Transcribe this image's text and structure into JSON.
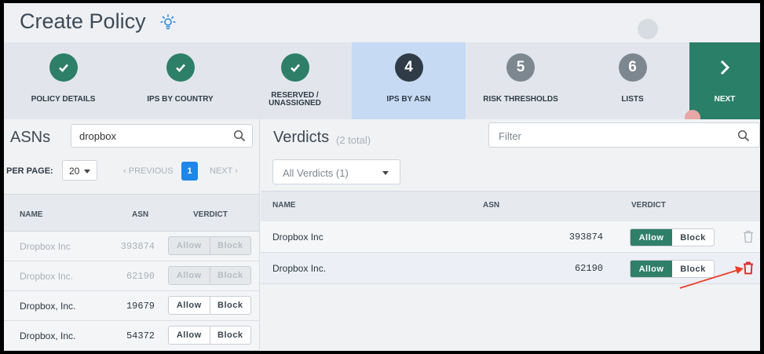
{
  "header": {
    "title": "Create Policy",
    "help_icon": "lightbulb-icon"
  },
  "stepper": {
    "steps": [
      {
        "number": "",
        "label": "POLICY DETAILS",
        "state": "done"
      },
      {
        "number": "",
        "label": "IPS BY COUNTRY",
        "state": "done"
      },
      {
        "number": "",
        "label": "RESERVED / UNASSIGNED",
        "state": "done"
      },
      {
        "number": "4",
        "label": "IPS BY ASN",
        "state": "active"
      },
      {
        "number": "5",
        "label": "RISK THRESHOLDS",
        "state": "todo"
      },
      {
        "number": "6",
        "label": "LISTS",
        "state": "todo"
      }
    ],
    "next_label": "NEXT"
  },
  "asns": {
    "title": "ASNs",
    "search_value": "dropbox",
    "per_page_label": "PER PAGE:",
    "per_page_value": "20",
    "prev_label": "PREVIOUS",
    "page": "1",
    "next_label": "NEXT",
    "columns": {
      "name": "NAME",
      "asn": "ASN",
      "verdict": "VERDICT"
    },
    "rows": [
      {
        "name": "Dropbox Inc",
        "asn": "393874",
        "allow": "Allow",
        "block": "Block",
        "disabled": true
      },
      {
        "name": "Dropbox Inc.",
        "asn": "62190",
        "allow": "Allow",
        "block": "Block",
        "disabled": true
      },
      {
        "name": "Dropbox, Inc.",
        "asn": "19679",
        "allow": "Allow",
        "block": "Block",
        "disabled": false
      },
      {
        "name": "Dropbox, Inc.",
        "asn": "54372",
        "allow": "Allow",
        "block": "Block",
        "disabled": false
      }
    ]
  },
  "verdicts": {
    "title": "Verdicts",
    "total": "(2 total)",
    "filter_placeholder": "Filter",
    "dropdown_value": "All Verdicts (1)",
    "columns": {
      "name": "NAME",
      "asn": "ASN",
      "verdict": "VERDICT"
    },
    "rows": [
      {
        "name": "Dropbox Inc",
        "asn": "393874",
        "allow": "Allow",
        "block": "Block",
        "selected": "Allow"
      },
      {
        "name": "Dropbox Inc.",
        "asn": "62190",
        "allow": "Allow",
        "block": "Block",
        "selected": "Allow"
      }
    ]
  },
  "colors": {
    "accent_green": "#2e7f67",
    "active_step_bg": "#c6daf3",
    "page_blue": "#1e86e8",
    "trash_active": "#e02020",
    "arrow": "#e8402a"
  }
}
